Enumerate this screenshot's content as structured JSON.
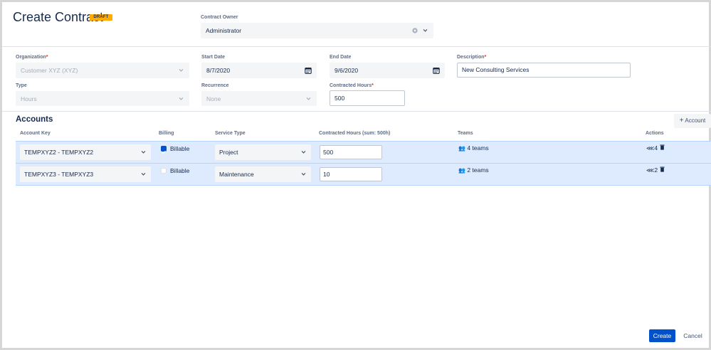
{
  "header": {
    "title": "Create Contract",
    "badge": "DRAFT"
  },
  "owner": {
    "label": "Contract Owner",
    "value": "Administrator"
  },
  "form": {
    "organization": {
      "label": "Organization",
      "value": "Customer XYZ (XYZ)"
    },
    "start_date": {
      "label": "Start Date",
      "value": "8/7/2020"
    },
    "end_date": {
      "label": "End Date",
      "value": "9/6/2020"
    },
    "description": {
      "label": "Description",
      "value": "New Consulting Services"
    },
    "type": {
      "label": "Type",
      "value": "Hours"
    },
    "recurrence": {
      "label": "Recurrence",
      "value": "None"
    },
    "contracted_hours": {
      "label": "Contracted Hours",
      "value": "500"
    },
    "required_mark": "*"
  },
  "accounts": {
    "title": "Accounts",
    "add_label": "Account",
    "columns": {
      "account_key": "Account Key",
      "billing": "Billing",
      "service_type": "Service Type",
      "contracted_hours": "Contracted Hours (sum: 500h)",
      "teams": "Teams",
      "actions": "Actions"
    },
    "rows": [
      {
        "account_key": "TEMPXYZ2 - TEMPXYZ2",
        "billable": true,
        "billing_label": "Billable",
        "service_type": "Project",
        "hours": "500",
        "teams": "4 teams",
        "action_count": "4"
      },
      {
        "account_key": "TEMPXYZ3 - TEMPXYZ3",
        "billable": false,
        "billing_label": "Billable",
        "service_type": "Maintenance",
        "hours": "10",
        "teams": "2 teams",
        "action_count": "2"
      }
    ]
  },
  "footer": {
    "create_label": "Create",
    "cancel_label": "Cancel"
  },
  "colors": {
    "accent": "#0052cc",
    "badge": "#ffab00",
    "row_highlight": "#deebff"
  }
}
